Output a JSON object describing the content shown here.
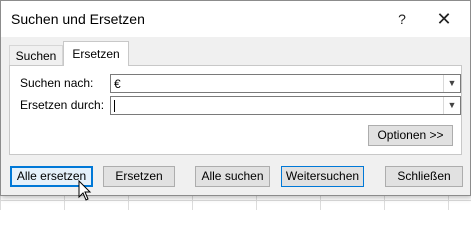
{
  "dialog": {
    "title": "Suchen und Ersetzen",
    "help": "?",
    "close": "✕"
  },
  "tabs": {
    "search": "Suchen",
    "replace": "Ersetzen"
  },
  "fields": {
    "find_label": "Suchen nach:",
    "find_value": "€",
    "replace_label": "Ersetzen durch:",
    "replace_value": ""
  },
  "buttons": {
    "options": "Optionen >>",
    "replace_all": "Alle ersetzen",
    "replace": "Ersetzen",
    "find_all": "Alle suchen",
    "find_next": "Weitersuchen",
    "close": "Schließen"
  },
  "icons": {
    "dropdown": "chevron-down-icon",
    "cursor": "mouse-pointer-icon"
  }
}
